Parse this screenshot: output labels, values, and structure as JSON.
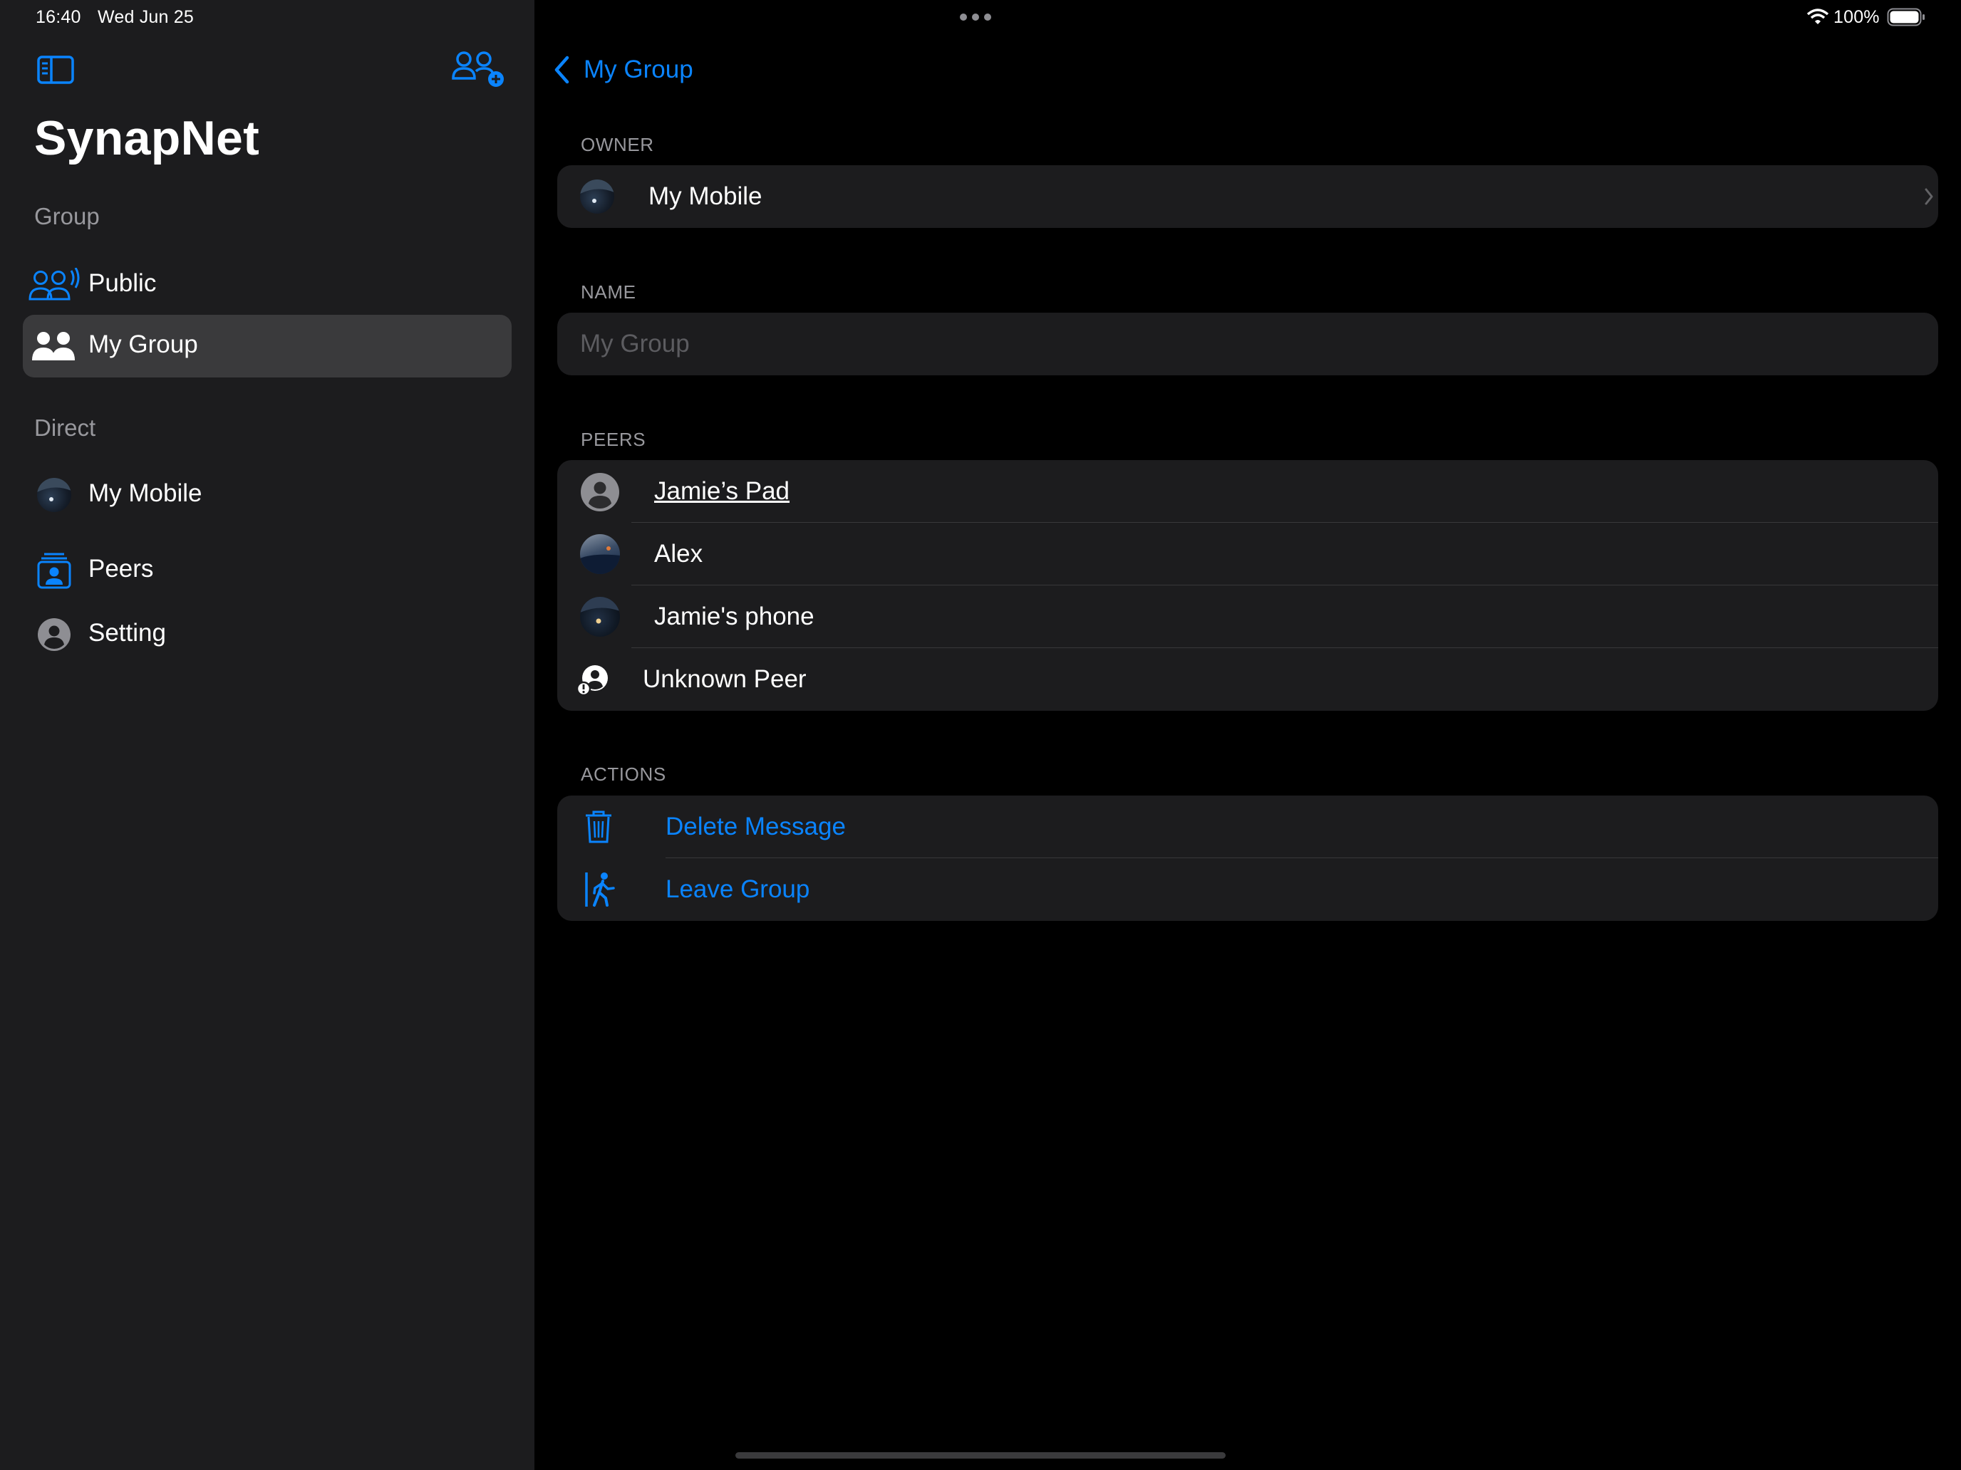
{
  "status_bar": {
    "time": "16:40",
    "date": "Wed Jun 25",
    "battery": "100%"
  },
  "sidebar": {
    "app_title": "SynapNet",
    "sections": {
      "group": "Group",
      "direct": "Direct"
    },
    "group_items": [
      {
        "label": "Public",
        "icon": "group-broadcast-icon"
      },
      {
        "label": "My Group",
        "icon": "group-icon",
        "selected": true
      }
    ],
    "direct_items": [
      {
        "label": "My Mobile",
        "icon": "avatar-image"
      },
      {
        "label": "Peers",
        "icon": "contacts-icon"
      },
      {
        "label": "Setting",
        "icon": "person-circle-icon"
      }
    ]
  },
  "detail": {
    "back_label": "My Group",
    "owner": {
      "header": "OWNER",
      "name": "My Mobile"
    },
    "name_field": {
      "header": "NAME",
      "placeholder": "My Group"
    },
    "peers": {
      "header": "PEERS",
      "items": [
        {
          "name": "Jamie’s Pad",
          "icon": "person-circle-icon"
        },
        {
          "name": "Alex",
          "icon": "avatar-image"
        },
        {
          "name": "Jamie's phone",
          "icon": "avatar-image"
        },
        {
          "name": "Unknown Peer",
          "icon": "unknown-person-icon"
        }
      ]
    },
    "actions": {
      "header": "ACTIONS",
      "items": [
        {
          "label": "Delete Message",
          "icon": "trash-icon"
        },
        {
          "label": "Leave Group",
          "icon": "exit-walk-icon"
        }
      ]
    }
  },
  "colors": {
    "accent": "#0a84ff",
    "sidebar_bg": "#1c1c1e",
    "card_bg": "#1c1c1e",
    "selected_bg": "#3a3a3c",
    "secondary_text": "#98989d"
  }
}
